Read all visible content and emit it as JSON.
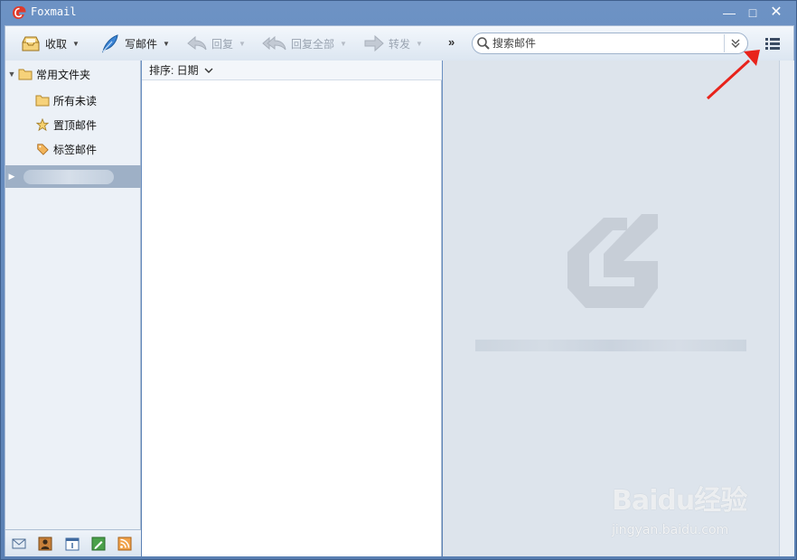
{
  "app": {
    "title": "Foxmail"
  },
  "window_controls": {
    "minimize": "—",
    "maximize": "□",
    "close": "✕"
  },
  "toolbar": {
    "receive": {
      "label": "收取",
      "icon": "inbox-tray-icon"
    },
    "compose": {
      "label": "写邮件",
      "icon": "feather-pen-icon"
    },
    "reply": {
      "label": "回复",
      "icon": "reply-arrow-icon",
      "enabled": false
    },
    "reply_all": {
      "label": "回复全部",
      "icon": "reply-all-arrow-icon",
      "enabled": false
    },
    "forward": {
      "label": "转发",
      "icon": "forward-arrow-icon",
      "enabled": false
    },
    "overflow": "»",
    "search_placeholder": "搜索邮件"
  },
  "sidebar": {
    "common_folders": "常用文件夹",
    "items": [
      {
        "label": "所有未读",
        "icon": "folder-icon"
      },
      {
        "label": "置顶邮件",
        "icon": "star-icon"
      },
      {
        "label": "标签邮件",
        "icon": "tag-icon"
      }
    ],
    "bottom_icons": [
      "mail-icon",
      "contacts-icon",
      "calendar-icon",
      "notes-icon",
      "rss-icon"
    ]
  },
  "maillist": {
    "sort_label": "排序: 日期"
  },
  "watermark": {
    "brand": "Baidu经验",
    "url": "jingyan.baidu.com"
  },
  "colors": {
    "accent": "#3d6fb0",
    "annotation_arrow": "#e8231b",
    "titlebar": "#6d92c4"
  }
}
